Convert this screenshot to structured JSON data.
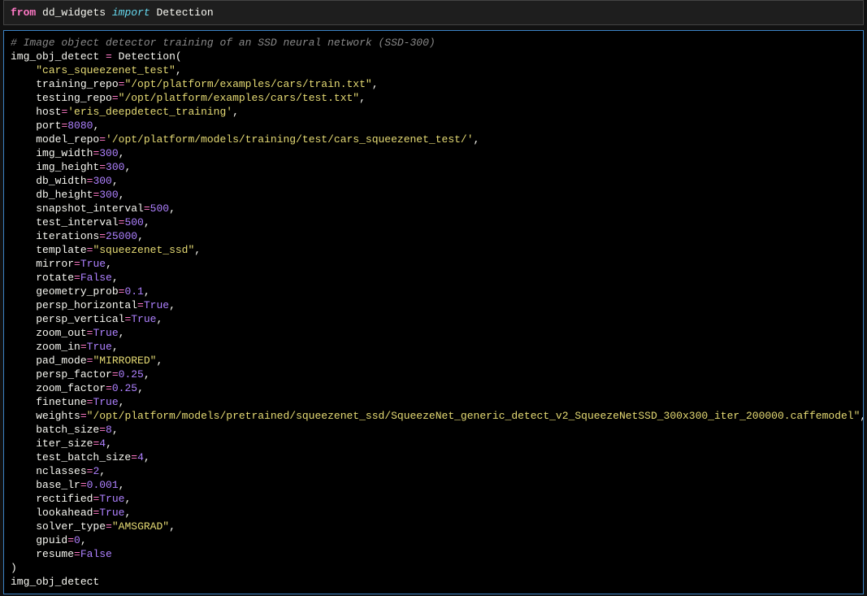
{
  "cell1": {
    "kw_from": "from",
    "mod": "dd_widgets",
    "kw_import": "import",
    "cls": "Detection"
  },
  "code": {
    "comment": "# Image object detector training of an SSD neural network (SSD-300)",
    "var": "img_obj_detect",
    "cls": "Detection",
    "params": [
      {
        "val": "\"cars_squeezenet_test\"",
        "t": "str"
      },
      {
        "key": "training_repo",
        "val": "\"/opt/platform/examples/cars/train.txt\"",
        "t": "str"
      },
      {
        "key": "testing_repo",
        "val": "\"/opt/platform/examples/cars/test.txt\"",
        "t": "str"
      },
      {
        "key": "host",
        "val": "'eris_deepdetect_training'",
        "t": "str"
      },
      {
        "key": "port",
        "val": "8080",
        "t": "num"
      },
      {
        "key": "model_repo",
        "val": "'/opt/platform/models/training/test/cars_squeezenet_test/'",
        "t": "str"
      },
      {
        "key": "img_width",
        "val": "300",
        "t": "num"
      },
      {
        "key": "img_height",
        "val": "300",
        "t": "num"
      },
      {
        "key": "db_width",
        "val": "300",
        "t": "num"
      },
      {
        "key": "db_height",
        "val": "300",
        "t": "num"
      },
      {
        "key": "snapshot_interval",
        "val": "500",
        "t": "num"
      },
      {
        "key": "test_interval",
        "val": "500",
        "t": "num"
      },
      {
        "key": "iterations",
        "val": "25000",
        "t": "num"
      },
      {
        "key": "template",
        "val": "\"squeezenet_ssd\"",
        "t": "str"
      },
      {
        "key": "mirror",
        "val": "True",
        "t": "bool"
      },
      {
        "key": "rotate",
        "val": "False",
        "t": "bool"
      },
      {
        "key": "geometry_prob",
        "val": "0.1",
        "t": "num"
      },
      {
        "key": "persp_horizontal",
        "val": "True",
        "t": "bool"
      },
      {
        "key": "persp_vertical",
        "val": "True",
        "t": "bool"
      },
      {
        "key": "zoom_out",
        "val": "True",
        "t": "bool"
      },
      {
        "key": "zoom_in",
        "val": "True",
        "t": "bool"
      },
      {
        "key": "pad_mode",
        "val": "\"MIRRORED\"",
        "t": "str"
      },
      {
        "key": "persp_factor",
        "val": "0.25",
        "t": "num"
      },
      {
        "key": "zoom_factor",
        "val": "0.25",
        "t": "num"
      },
      {
        "key": "finetune",
        "val": "True",
        "t": "bool"
      },
      {
        "key": "weights",
        "val": "\"/opt/platform/models/pretrained/squeezenet_ssd/SqueezeNet_generic_detect_v2_SqueezeNetSSD_300x300_iter_200000.caffemodel\"",
        "t": "str"
      },
      {
        "key": "batch_size",
        "val": "8",
        "t": "num"
      },
      {
        "key": "iter_size",
        "val": "4",
        "t": "num"
      },
      {
        "key": "test_batch_size",
        "val": "4",
        "t": "num"
      },
      {
        "key": "nclasses",
        "val": "2",
        "t": "num"
      },
      {
        "key": "base_lr",
        "val": "0.001",
        "t": "num"
      },
      {
        "key": "rectified",
        "val": "True",
        "t": "bool"
      },
      {
        "key": "lookahead",
        "val": "True",
        "t": "bool"
      },
      {
        "key": "solver_type",
        "val": "\"AMSGRAD\"",
        "t": "str"
      },
      {
        "key": "gpuid",
        "val": "0",
        "t": "num"
      },
      {
        "key": "resume",
        "val": "False",
        "t": "bool",
        "last": true
      }
    ],
    "tail": "img_obj_detect"
  }
}
